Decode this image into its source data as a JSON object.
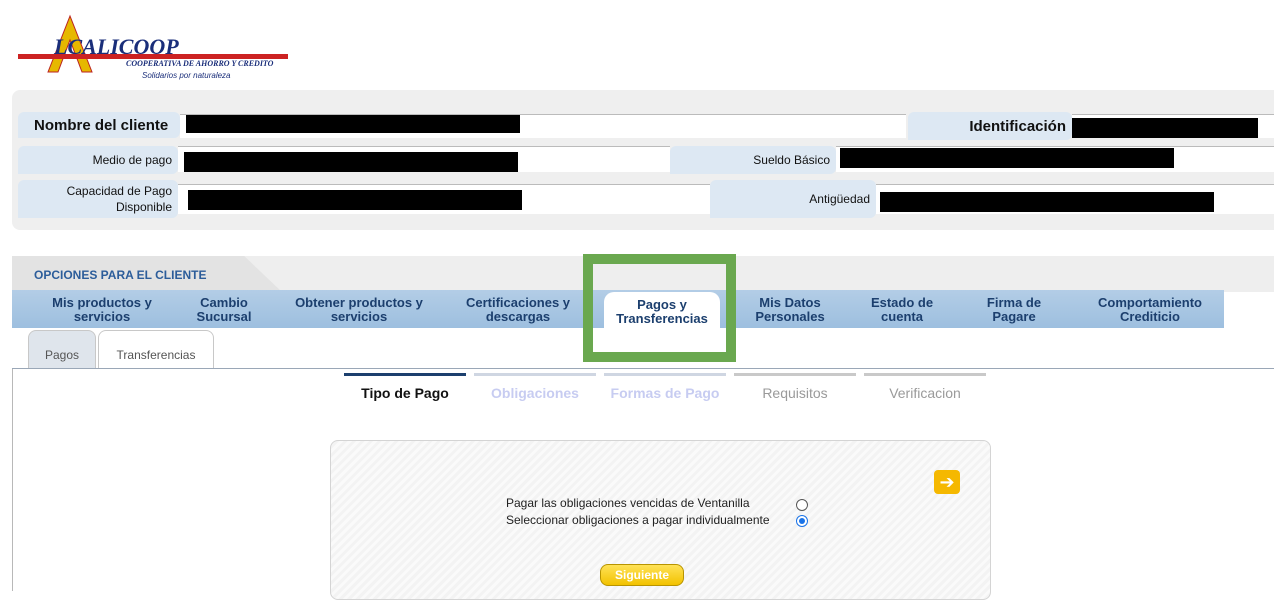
{
  "logo": {
    "brand_a": "A",
    "brand_name": "LCALICOOP",
    "tagline": "COOPERATIVA DE AHORRO Y CREDITO",
    "slogan": "Solidarios por naturaleza"
  },
  "client_info": {
    "name_label": "Nombre del cliente",
    "id_label": "Identificación",
    "payment_method_label": "Medio de pago",
    "salary_label": "Sueldo Básico",
    "capacity_label_1": "Capacidad de Pago",
    "capacity_label_2": "Disponible",
    "seniority_label": "Antigüedad"
  },
  "options_tab": "OPCIONES PARA EL CLIENTE",
  "nav": [
    {
      "l1": "Mis productos y",
      "l2": "servicios"
    },
    {
      "l1": "Cambio",
      "l2": "Sucursal"
    },
    {
      "l1": "Obtener productos y",
      "l2": "servicios"
    },
    {
      "l1": "Certificaciones y",
      "l2": "descargas"
    },
    {
      "l1": "Pagos y",
      "l2": "Transferencias"
    },
    {
      "l1": "Mis Datos",
      "l2": "Personales"
    },
    {
      "l1": "Estado de",
      "l2": "cuenta"
    },
    {
      "l1": "Firma de",
      "l2": "Pagare"
    },
    {
      "l1": "Comportamiento",
      "l2": "Crediticio"
    }
  ],
  "subtabs": [
    "Pagos",
    "Transferencias"
  ],
  "steps": [
    "Tipo de Pago",
    "Obligaciones",
    "Formas de Pago",
    "Requisitos",
    "Verificacion"
  ],
  "form": {
    "option_1": "Pagar las obligaciones vencidas de Ventanilla",
    "option_2": "Seleccionar obligaciones a pagar individualmente",
    "selected_option": 2,
    "arrow": "➔",
    "next_button": "Siguiente"
  },
  "colors": {
    "nav_bar": "#a8c6e3",
    "highlight": "#6aa84f",
    "button": "#f5c400",
    "step_active": "#1c3f6e"
  }
}
